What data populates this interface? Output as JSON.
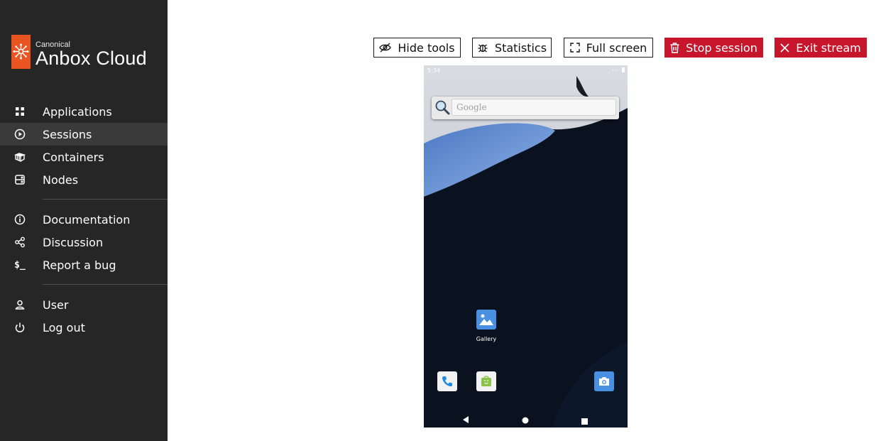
{
  "brand": {
    "company": "Canonical",
    "product": "Anbox Cloud",
    "accent_color": "#e95420"
  },
  "sidebar": {
    "main_items": [
      {
        "label": "Applications",
        "icon": "grid-icon"
      },
      {
        "label": "Sessions",
        "icon": "play-circle-icon",
        "active": true
      },
      {
        "label": "Containers",
        "icon": "containers-icon"
      },
      {
        "label": "Nodes",
        "icon": "server-icon"
      }
    ],
    "help_items": [
      {
        "label": "Documentation",
        "icon": "info-icon"
      },
      {
        "label": "Discussion",
        "icon": "share-icon"
      },
      {
        "label": "Report a bug",
        "icon": "terminal-icon"
      }
    ],
    "account_items": [
      {
        "label": "User",
        "icon": "user-icon"
      },
      {
        "label": "Log out",
        "icon": "power-icon"
      }
    ]
  },
  "toolbar": {
    "hide_tools": "Hide tools",
    "statistics": "Statistics",
    "full_screen": "Full screen",
    "stop_session": "Stop session",
    "exit_stream": "Exit stream",
    "danger_color": "#c7162b"
  },
  "device": {
    "status_time": "5:34",
    "search_placeholder": "Google",
    "apps": [
      {
        "label": "Gallery",
        "icon": "gallery-icon"
      }
    ],
    "dock": [
      {
        "icon": "phone-icon"
      },
      {
        "icon": "app-store-icon"
      },
      {
        "icon": "camera-icon"
      }
    ],
    "nav_buttons": [
      "back-icon",
      "home-icon",
      "recents-icon"
    ]
  }
}
